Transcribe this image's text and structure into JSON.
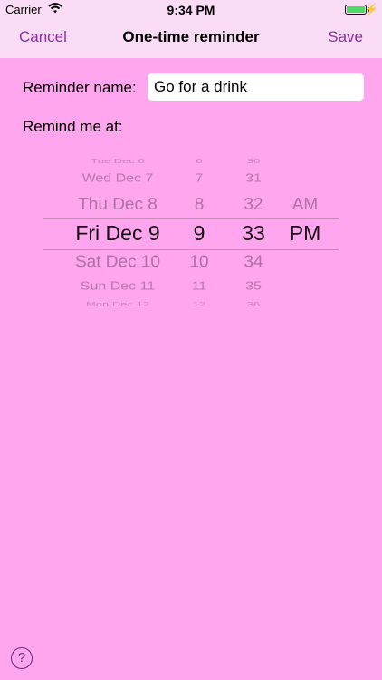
{
  "status_bar": {
    "carrier": "Carrier",
    "time": "9:34 PM",
    "icons": [
      "wifi-icon",
      "battery-icon",
      "charging-bolt-icon"
    ],
    "battery_color": "#4cd964"
  },
  "nav": {
    "cancel_label": "Cancel",
    "title": "One-time reminder",
    "save_label": "Save",
    "accent_color": "#8a2ea6"
  },
  "form": {
    "name_label": "Reminder name:",
    "name_value": "Go for a drink",
    "remind_label": "Remind me at:"
  },
  "picker": {
    "dates": [
      "Tue Dec 6",
      "Wed Dec 7",
      "Thu Dec 8",
      "Fri Dec 9",
      "Sat Dec 10",
      "Sun Dec 11",
      "Mon Dec 12"
    ],
    "hours": [
      "6",
      "7",
      "8",
      "9",
      "10",
      "11",
      "12"
    ],
    "minutes": [
      "30",
      "31",
      "32",
      "33",
      "34",
      "35",
      "36"
    ],
    "ampm": [
      "AM",
      "PM"
    ],
    "selected": {
      "date": "Fri Dec 9",
      "hour": "9",
      "minute": "33",
      "ampm": "PM"
    }
  },
  "help": {
    "label": "?"
  },
  "colors": {
    "background": "#ffa6ee",
    "bar": "#fbdcf6"
  }
}
